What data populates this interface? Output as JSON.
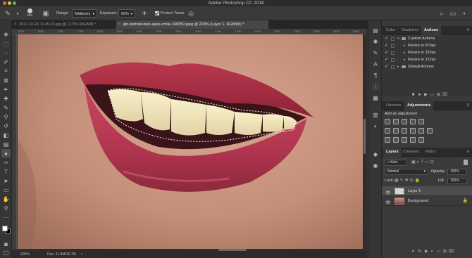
{
  "window": {
    "title": "Adobe Photoshop CC 2018"
  },
  "options_bar": {
    "brush_size": "200",
    "range_label": "Range:",
    "range_value": "Midtones",
    "exposure_label": "Exposure:",
    "exposure_value": "50%",
    "protect_tones_label": "Protect Tones",
    "protect_tones_checked": true
  },
  "tabs": [
    {
      "label": "2017-10-29 11.45.30.jpg @ 12.5% (RGB/8) *",
      "active": false
    },
    {
      "label": "girl-portrait-dark-eyes-smile-160959.jpeg @ 200% (Layer 1, RGB/8#) *",
      "active": true
    }
  ],
  "ruler_ticks": [
    "1600",
    "1650",
    "1700",
    "1750",
    "1800",
    "1850",
    "1900",
    "1950",
    "2000",
    "2050",
    "2100",
    "2150",
    "2200",
    "2250",
    "2300",
    "2350",
    "2400",
    "2450"
  ],
  "status": {
    "zoom": "200%",
    "doc": "Doc: 31.8M/30.7M"
  },
  "color_panel": {
    "tabs": [
      "Color",
      "Swatches",
      "Actions"
    ],
    "active_tab": "Actions"
  },
  "actions": [
    {
      "label": "Custom Actions",
      "type": "set",
      "expanded": true
    },
    {
      "label": "Resize to 670px",
      "type": "action"
    },
    {
      "label": "Resize to 333px",
      "type": "action"
    },
    {
      "label": "Resize to 222px",
      "type": "action"
    },
    {
      "label": "Default Actions",
      "type": "set",
      "expanded": false
    }
  ],
  "adjustments_panel": {
    "tabs": [
      "Libraries",
      "Adjustments"
    ],
    "active_tab": "Adjustments",
    "heading": "Add an adjustment"
  },
  "layers_panel": {
    "tabs": [
      "Layers",
      "Channels",
      "Paths"
    ],
    "active_tab": "Layers",
    "filter_kind": "Kind",
    "blend_mode": "Normal",
    "opacity_label": "Opacity:",
    "opacity_value": "100%",
    "lock_label": "Lock:",
    "fill_label": "Fill:",
    "fill_value": "100%",
    "layers": [
      {
        "name": "Layer 1",
        "selected": true,
        "locked": false
      },
      {
        "name": "Background",
        "selected": false,
        "locked": true
      }
    ]
  },
  "colors": {
    "app_bg": "#323232",
    "panel_bg": "#3a3a3a",
    "accent": "#e6e6e6"
  }
}
